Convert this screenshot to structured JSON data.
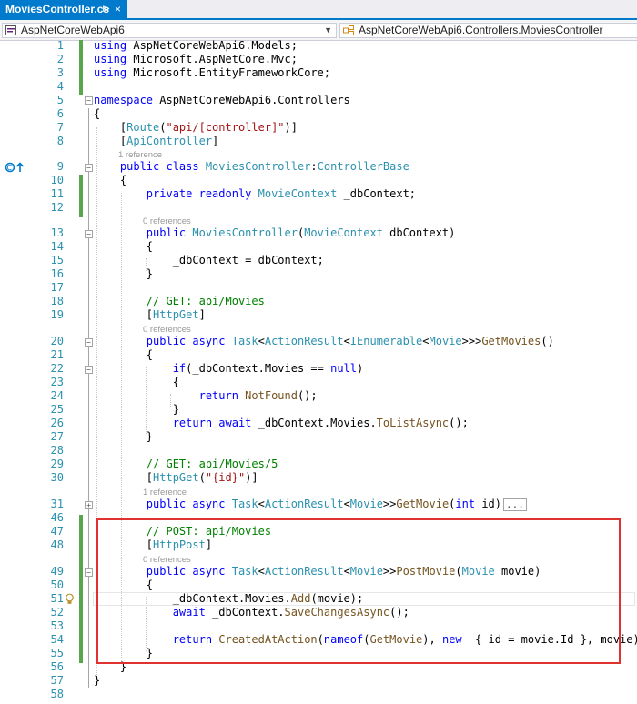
{
  "tab": {
    "title": "MoviesController.cs",
    "pin_icon": "⊳",
    "close_icon": "×"
  },
  "navbar": {
    "project": "AspNetCoreWebApi6",
    "member": "AspNetCoreWebApi6.Controllers.MoviesController"
  },
  "lines": [
    {
      "n": "1",
      "t": 51,
      "segs": [
        [
          "kw",
          "using"
        ],
        [
          "",
          "AspNetCoreWebApi6.Models;"
        ]
      ]
    },
    {
      "n": "2",
      "t": 66,
      "segs": [
        [
          "kw",
          "using"
        ],
        [
          "",
          "Microsoft.AspNetCore.Mvc;"
        ]
      ]
    },
    {
      "n": "3",
      "t": 81,
      "segs": [
        [
          "kw",
          "using"
        ],
        [
          "",
          "Microsoft.EntityFrameworkCore;"
        ]
      ]
    },
    {
      "n": "4",
      "t": 96,
      "segs": []
    },
    {
      "n": "5",
      "t": 111,
      "segs": [
        [
          "kw",
          "namespace"
        ],
        [
          "",
          "AspNetCoreWebApi6.Controllers"
        ]
      ]
    },
    {
      "n": "6",
      "t": 126,
      "segs": [
        [
          "",
          "{"
        ]
      ]
    },
    {
      "n": "7",
      "t": 141,
      "segs": [
        [
          "",
          "    ["
        ],
        [
          "ty",
          "Route"
        ],
        [
          "",
          "("
        ],
        [
          "st",
          "\"api/[controller]\""
        ],
        [
          "",
          ")]"
        ]
      ]
    },
    {
      "n": "8",
      "t": 156,
      "segs": [
        [
          "",
          "    ["
        ],
        [
          "ty",
          "ApiController"
        ],
        [
          "",
          "]"
        ]
      ]
    },
    {
      "n": "9",
      "t": 184,
      "segs": [
        [
          "",
          "    "
        ],
        [
          "kw",
          "public class"
        ],
        [
          "",
          ""
        ],
        [
          "ty",
          "MoviesController"
        ],
        [
          "",
          ":"
        ],
        [
          "ty",
          "ControllerBase"
        ]
      ]
    },
    {
      "n": "10",
      "t": 199,
      "segs": [
        [
          "",
          "    {"
        ]
      ]
    },
    {
      "n": "11",
      "t": 214,
      "segs": [
        [
          "",
          "        "
        ],
        [
          "kw",
          "private readonly"
        ],
        [
          "",
          ""
        ],
        [
          "ty",
          "MovieContext"
        ],
        [
          "",
          "_dbContext;"
        ]
      ]
    },
    {
      "n": "12",
      "t": 229,
      "segs": []
    },
    {
      "n": "13",
      "t": 257,
      "segs": [
        [
          "",
          "        "
        ],
        [
          "kw",
          "public"
        ],
        [
          "",
          ""
        ],
        [
          "ty",
          "MoviesController"
        ],
        [
          "",
          "("
        ],
        [
          "ty",
          "MovieContext"
        ],
        [
          "",
          "dbContext)"
        ]
      ]
    },
    {
      "n": "14",
      "t": 272,
      "segs": [
        [
          "",
          "        {"
        ]
      ]
    },
    {
      "n": "15",
      "t": 287,
      "segs": [
        [
          "",
          "            _dbContext = dbContext;"
        ]
      ]
    },
    {
      "n": "16",
      "t": 302,
      "segs": [
        [
          "",
          "        }"
        ]
      ]
    },
    {
      "n": "17",
      "t": 317,
      "segs": []
    },
    {
      "n": "18",
      "t": 332,
      "segs": [
        [
          "",
          "        "
        ],
        [
          "cm",
          "// GET: api/Movies"
        ]
      ]
    },
    {
      "n": "19",
      "t": 347,
      "segs": [
        [
          "",
          "        ["
        ],
        [
          "ty",
          "HttpGet"
        ],
        [
          "",
          "]"
        ]
      ]
    },
    {
      "n": "20",
      "t": 376,
      "segs": [
        [
          "",
          "        "
        ],
        [
          "kw",
          "public async"
        ],
        [
          "",
          ""
        ],
        [
          "ty",
          "Task"
        ],
        [
          "",
          "<"
        ],
        [
          "ty",
          "ActionResult"
        ],
        [
          "",
          "<"
        ],
        [
          "ty",
          "IEnumerable"
        ],
        [
          "",
          "<"
        ],
        [
          "ty",
          "Movie"
        ],
        [
          "",
          ">>>"
        ],
        [
          "mt",
          "GetMovies"
        ],
        [
          "",
          "()"
        ]
      ]
    },
    {
      "n": "21",
      "t": 391,
      "segs": [
        [
          "",
          "        {"
        ]
      ]
    },
    {
      "n": "22",
      "t": 406,
      "segs": [
        [
          "",
          "            "
        ],
        [
          "kw",
          "if"
        ],
        [
          "",
          "(_dbContext.Movies == "
        ],
        [
          "kw",
          "null"
        ],
        [
          "",
          ")"
        ]
      ]
    },
    {
      "n": "23",
      "t": 421,
      "segs": [
        [
          "",
          "            {"
        ]
      ]
    },
    {
      "n": "24",
      "t": 436,
      "segs": [
        [
          "",
          "                "
        ],
        [
          "kw",
          "return"
        ],
        [
          "",
          ""
        ],
        [
          "mt",
          "NotFound"
        ],
        [
          "",
          "();"
        ]
      ]
    },
    {
      "n": "25",
      "t": 451,
      "segs": [
        [
          "",
          "            }"
        ]
      ]
    },
    {
      "n": "26",
      "t": 466,
      "segs": [
        [
          "",
          "            "
        ],
        [
          "kw",
          "return await"
        ],
        [
          "",
          "_dbContext.Movies."
        ],
        [
          "mt",
          "ToListAsync"
        ],
        [
          "",
          "();"
        ]
      ]
    },
    {
      "n": "27",
      "t": 481,
      "segs": [
        [
          "",
          "        }"
        ]
      ]
    },
    {
      "n": "28",
      "t": 496,
      "segs": []
    },
    {
      "n": "29",
      "t": 511,
      "segs": [
        [
          "",
          "        "
        ],
        [
          "cm",
          "// GET: api/Movies/5"
        ]
      ]
    },
    {
      "n": "30",
      "t": 526,
      "segs": [
        [
          "",
          "        ["
        ],
        [
          "ty",
          "HttpGet"
        ],
        [
          "",
          "("
        ],
        [
          "st",
          "\"{id}\""
        ],
        [
          "",
          ")]"
        ]
      ]
    },
    {
      "n": "31",
      "t": 555,
      "segs": [
        [
          "",
          "        "
        ],
        [
          "kw",
          "public async"
        ],
        [
          "",
          ""
        ],
        [
          "ty",
          "Task"
        ],
        [
          "",
          "<"
        ],
        [
          "ty",
          "ActionResult"
        ],
        [
          "",
          "<"
        ],
        [
          "ty",
          "Movie"
        ],
        [
          "",
          ">>"
        ],
        [
          "mt",
          "GetMovie"
        ],
        [
          "",
          "("
        ],
        [
          "kw",
          "int"
        ],
        [
          "",
          "id)"
        ]
      ]
    },
    {
      "n": "46",
      "t": 570,
      "segs": []
    },
    {
      "n": "47",
      "t": 585,
      "segs": [
        [
          "",
          "        "
        ],
        [
          "cm",
          "// POST: api/Movies"
        ]
      ]
    },
    {
      "n": "48",
      "t": 600,
      "segs": [
        [
          "",
          "        ["
        ],
        [
          "ty",
          "HttpPost"
        ],
        [
          "",
          "]"
        ]
      ]
    },
    {
      "n": "49",
      "t": 629,
      "segs": [
        [
          "",
          "        "
        ],
        [
          "kw",
          "public async"
        ],
        [
          "",
          ""
        ],
        [
          "ty",
          "Task"
        ],
        [
          "",
          "<"
        ],
        [
          "ty",
          "ActionResult"
        ],
        [
          "",
          "<"
        ],
        [
          "ty",
          "Movie"
        ],
        [
          "",
          ">>"
        ],
        [
          "mt",
          "PostMovie"
        ],
        [
          "",
          "("
        ],
        [
          "ty",
          "Movie"
        ],
        [
          "",
          "movie)"
        ]
      ]
    },
    {
      "n": "50",
      "t": 644,
      "segs": [
        [
          "",
          "        {"
        ]
      ]
    },
    {
      "n": "51",
      "t": 659,
      "segs": [
        [
          "",
          "            _dbContext.Movies."
        ],
        [
          "mt",
          "Add"
        ],
        [
          "",
          "(movie);"
        ]
      ]
    },
    {
      "n": "52",
      "t": 674,
      "segs": [
        [
          "",
          "            "
        ],
        [
          "kw",
          "await"
        ],
        [
          "",
          "_dbContext."
        ],
        [
          "mt",
          "SaveChangesAsync"
        ],
        [
          "",
          "();"
        ]
      ]
    },
    {
      "n": "53",
      "t": 689,
      "segs": []
    },
    {
      "n": "54",
      "t": 704,
      "segs": [
        [
          "",
          "            "
        ],
        [
          "kw",
          "return"
        ],
        [
          "",
          ""
        ],
        [
          "mt",
          "CreatedAtAction"
        ],
        [
          "",
          "("
        ],
        [
          "kw",
          "nameof"
        ],
        [
          "",
          "("
        ],
        [
          "mt",
          "GetMovie"
        ],
        [
          "",
          "), "
        ],
        [
          "kw",
          "new"
        ],
        [
          "",
          " { id = movie.Id }, movie);"
        ]
      ]
    },
    {
      "n": "55",
      "t": 719,
      "segs": [
        [
          "",
          "        }"
        ]
      ]
    },
    {
      "n": "56",
      "t": 734,
      "segs": [
        [
          "",
          "    }"
        ]
      ]
    },
    {
      "n": "57",
      "t": 749,
      "segs": [
        [
          "",
          "}"
        ]
      ]
    },
    {
      "n": "58",
      "t": 764,
      "segs": []
    }
  ],
  "codelens": [
    {
      "text": "1 reference",
      "t": 171
    },
    {
      "text": "0 references",
      "t": 244
    },
    {
      "text": "0 references",
      "t": 363
    },
    {
      "text": "1 reference",
      "t": 542
    },
    {
      "text": "0 references",
      "t": 616
    }
  ],
  "collapsed_ellipsis": "...",
  "colors": {
    "accent": "#007acc",
    "change_bar": "#57a64a",
    "highlight_border": "#e0312f"
  }
}
